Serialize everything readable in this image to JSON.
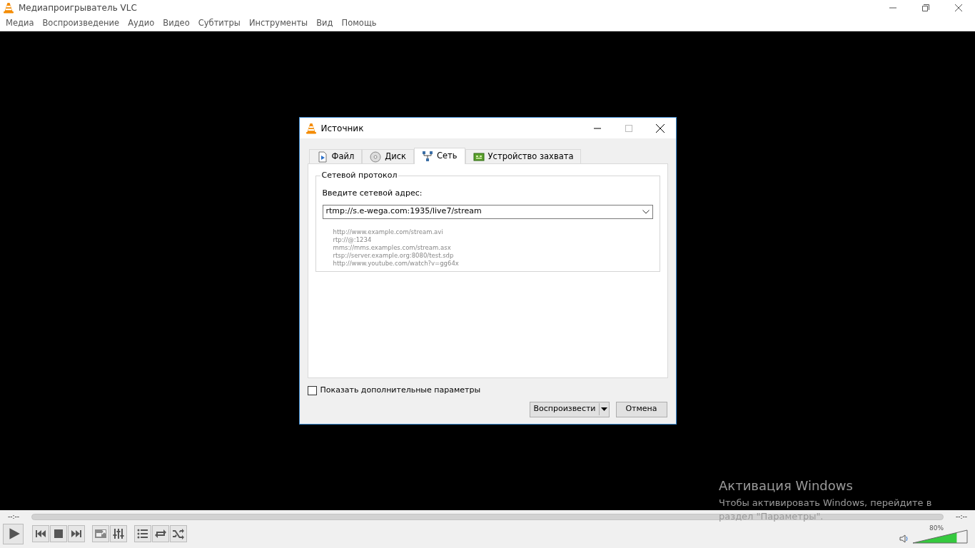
{
  "window": {
    "title": "Медиапроигрыватель VLC"
  },
  "menu": [
    "Медиа",
    "Воспроизведение",
    "Аудио",
    "Видео",
    "Субтитры",
    "Инструменты",
    "Вид",
    "Помощь"
  ],
  "dialog": {
    "title": "Источник",
    "tabs": [
      {
        "label": "Файл",
        "kind": "file",
        "selected": false
      },
      {
        "label": "Диск",
        "kind": "disc",
        "selected": false
      },
      {
        "label": "Сеть",
        "kind": "network",
        "selected": true
      },
      {
        "label": "Устройство захвата",
        "kind": "capture",
        "selected": false
      }
    ],
    "group_title": "Сетевой протокол",
    "address_label": "Введите сетевой адрес:",
    "address_value": "rtmp://s.e-wega.com:1935/live7/stream",
    "examples": [
      "http://www.example.com/stream.avi",
      "rtp://@:1234",
      "mms://mms.examples.com/stream.asx",
      "rtsp://server.example.org:8080/test.sdp",
      "http://www.youtube.com/watch?v=gg64x"
    ],
    "show_more": {
      "label": "Показать дополнительные параметры",
      "checked": false
    },
    "buttons": [
      "Воспроизвести",
      "Отмена"
    ]
  },
  "player": {
    "time_elapsed": "--:--",
    "time_total": "--:--",
    "volume": {
      "level": 0.8,
      "reading": "80%"
    },
    "controls": [
      {
        "kind": "play"
      },
      {
        "kind": "prev"
      },
      {
        "kind": "stop"
      },
      {
        "kind": "next"
      },
      {
        "kind": "fullscreen"
      },
      {
        "kind": "settings"
      },
      {
        "kind": "playlist"
      },
      {
        "kind": "loop"
      },
      {
        "kind": "random"
      }
    ]
  },
  "activation": {
    "title": "Активация Windows",
    "text": "Чтобы активировать Windows, перейдите в раздел \"Параметры\"."
  }
}
